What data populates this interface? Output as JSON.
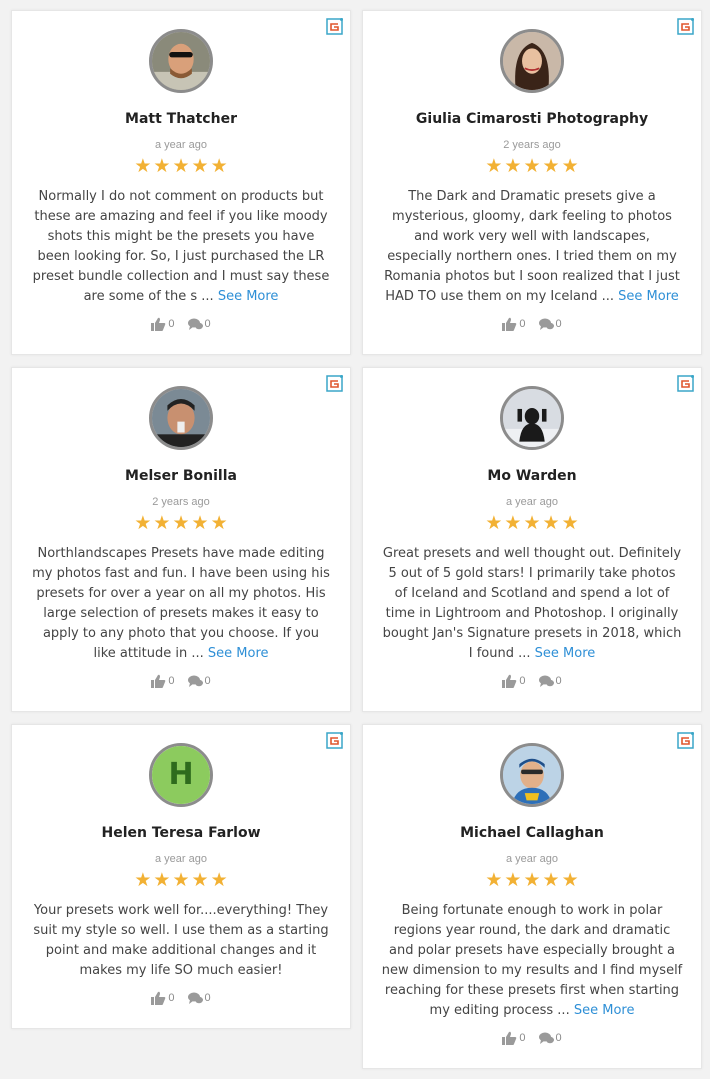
{
  "reviews": [
    {
      "name": "Matt Thatcher",
      "time": "a year ago",
      "rating": 5,
      "text": "Normally I do not comment on products but these are amazing and feel if you like moody shots this might be the presets you have been looking for. So, I just purchased the LR preset bundle collection and I must say these are some of the s ...",
      "see_more": "See More",
      "likes": "0",
      "comments": "0",
      "avatar": "photo"
    },
    {
      "name": "Giulia Cimarosti Photography",
      "time": "2 years ago",
      "rating": 5,
      "text": "The Dark and Dramatic presets give a mysterious, gloomy, dark feeling to photos and work very well with landscapes, especially northern ones. I tried them on my Romania photos but I soon realized that I just HAD TO use them on my Iceland ...",
      "see_more": "See More",
      "likes": "0",
      "comments": "0",
      "avatar": "photo"
    },
    {
      "name": "Melser Bonilla",
      "time": "2 years ago",
      "rating": 5,
      "text": "Northlandscapes Presets have made editing my photos fast and fun. I have been using his presets for over a year on all my photos. His large selection of presets makes it easy to apply to any photo that you choose. If you like attitude in ...",
      "see_more": "See More",
      "likes": "0",
      "comments": "0",
      "avatar": "photo"
    },
    {
      "name": "Mo Warden",
      "time": "a year ago",
      "rating": 5,
      "text": "Great presets and well thought out. Definitely 5 out of 5 gold stars! I primarily take photos of Iceland and Scotland and spend a lot of time in Lightroom and Photoshop. I originally bought Jan's Signature presets in 2018, which I found ...",
      "see_more": "See More",
      "likes": "0",
      "comments": "0",
      "avatar": "photo"
    },
    {
      "name": "Helen Teresa Farlow",
      "time": "a year ago",
      "rating": 5,
      "text": "Your presets work well for....everything! They suit my style so well. I use them as a starting point and make additional changes and it makes my life SO much easier!",
      "see_more": "",
      "likes": "0",
      "comments": "0",
      "avatar": "letter",
      "avatar_letter": "H"
    },
    {
      "name": "Michael Callaghan",
      "time": "a year ago",
      "rating": 5,
      "text": "Being fortunate enough to work in polar regions year round, the dark and dramatic and polar presets have especially brought a new dimension to my results and I find myself reaching for these presets first when starting my editing process ...",
      "see_more": "See More",
      "likes": "0",
      "comments": "0",
      "avatar": "photo"
    }
  ],
  "colors": {
    "star": "#f2b134",
    "link": "#2e8fd6",
    "avatar_letter_bg": "#8ccb5e"
  }
}
